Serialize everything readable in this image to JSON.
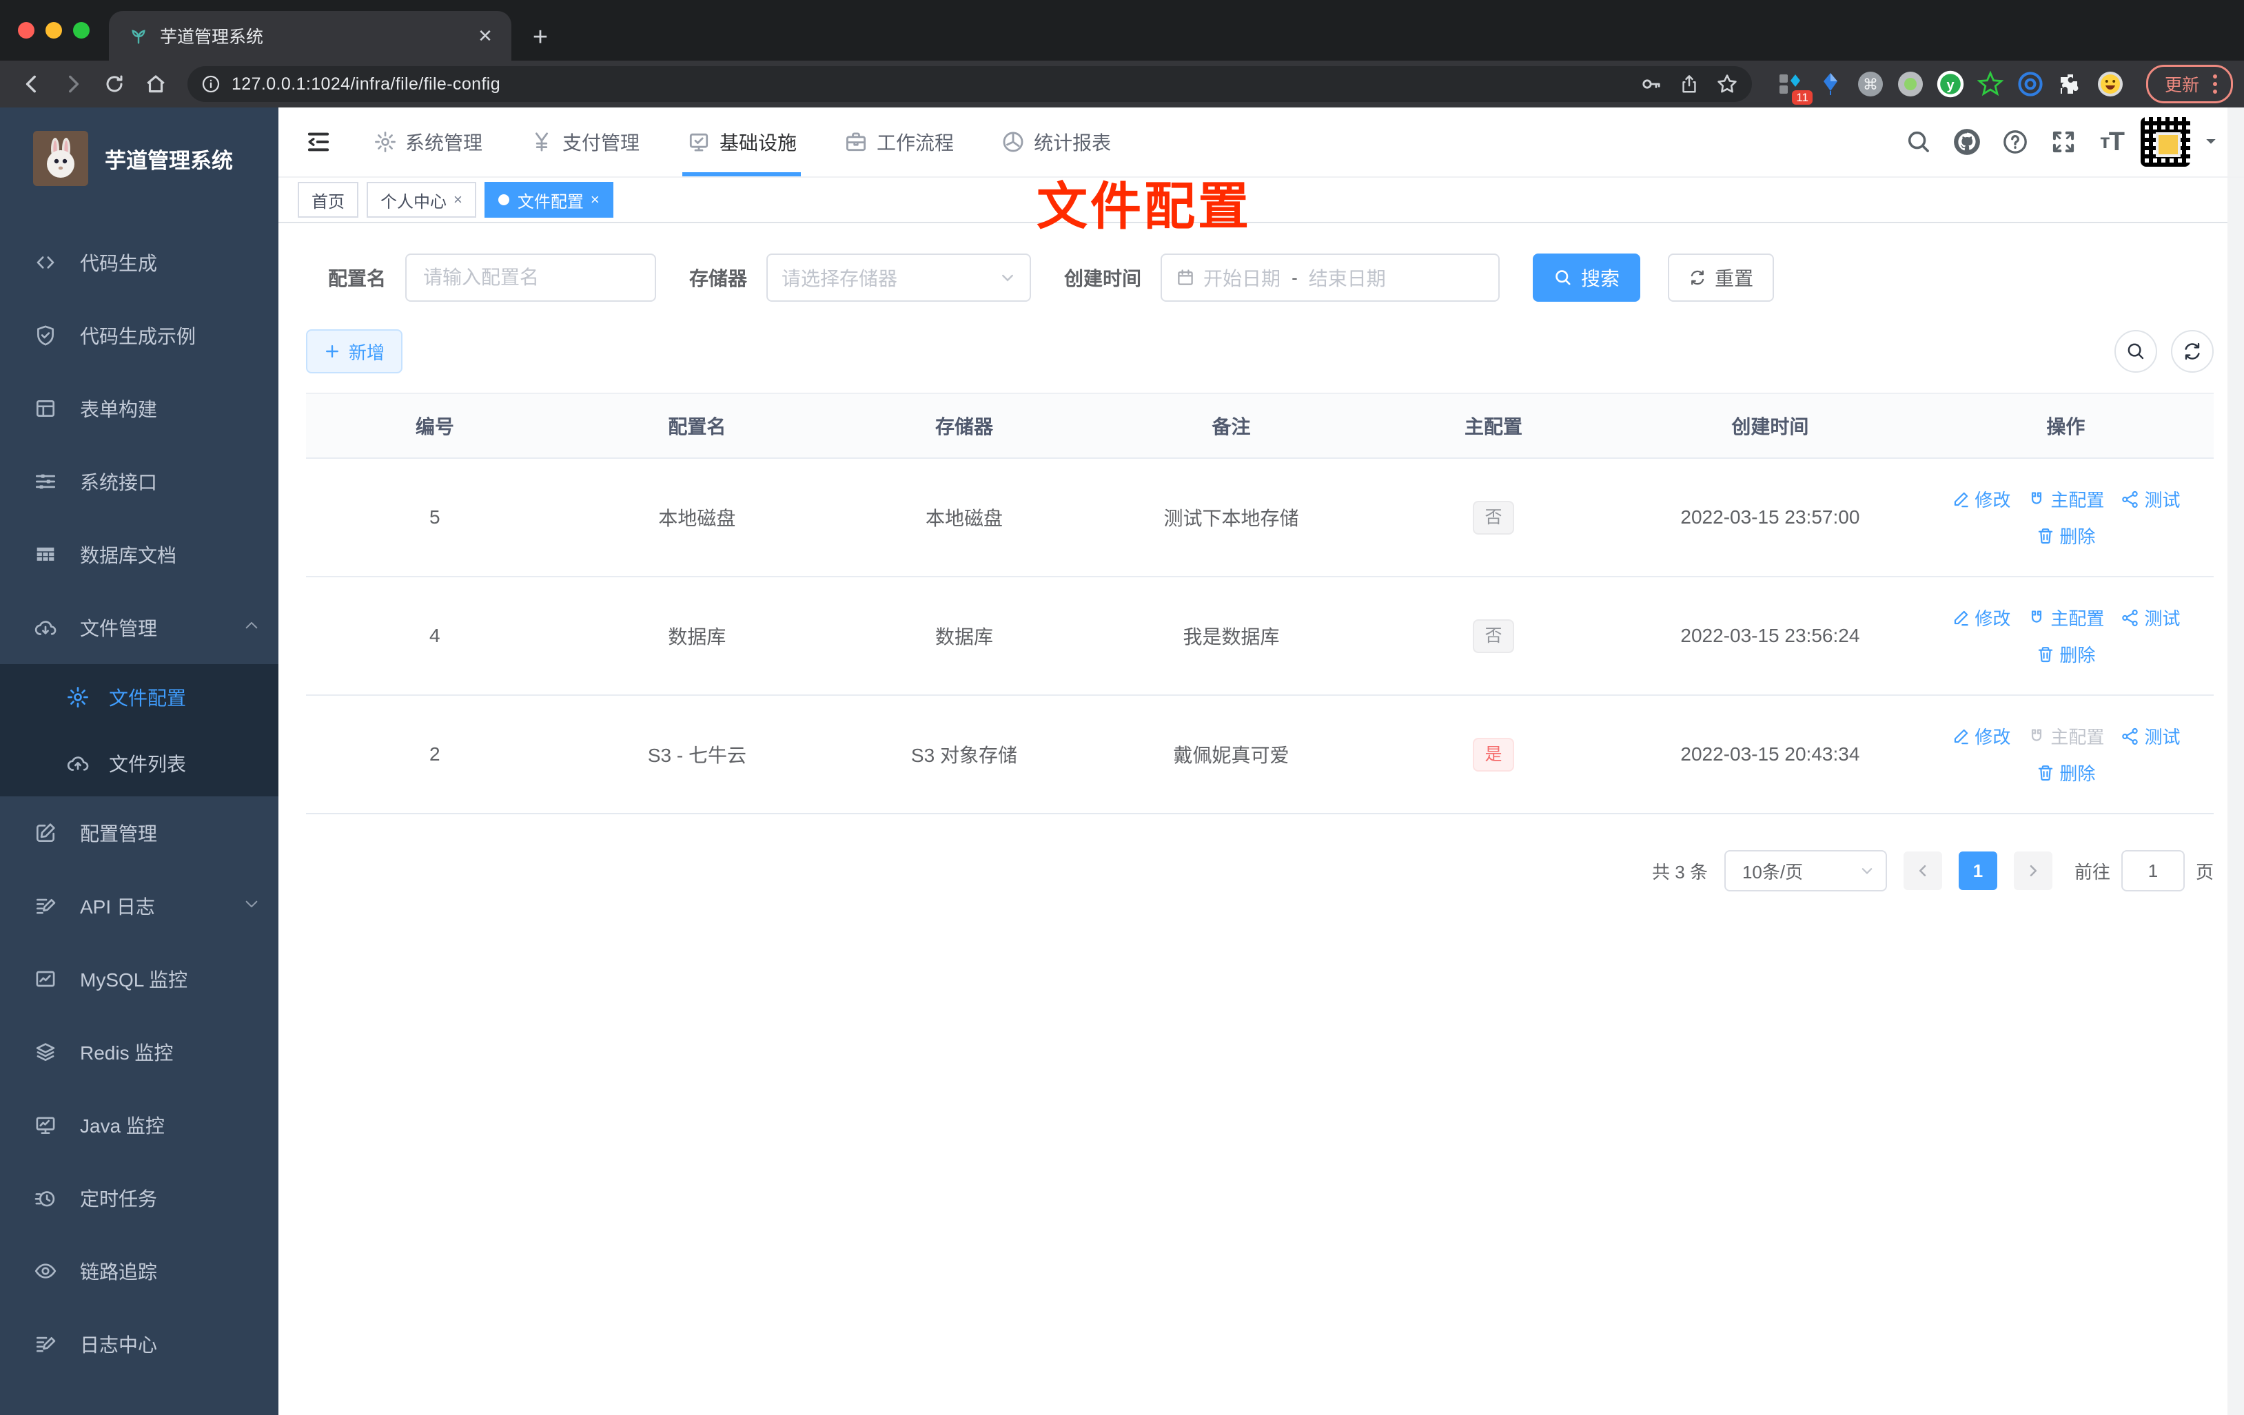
{
  "browser": {
    "tab_title": "芋道管理系统",
    "url": "127.0.0.1:1024/infra/file/file-config",
    "update_label": "更新",
    "extensions": [
      {
        "icon": "ext-grid-blue-icon",
        "badge": "11"
      },
      {
        "icon": "ext-kite-icon"
      },
      {
        "icon": "ext-command-icon"
      },
      {
        "icon": "ext-green-dot-icon"
      },
      {
        "icon": "ext-y-green-icon"
      },
      {
        "icon": "ext-star-green-icon"
      },
      {
        "icon": "ext-blue-rings-icon"
      },
      {
        "icon": "ext-puzzle-icon"
      },
      {
        "icon": "ext-emoji-icon"
      }
    ]
  },
  "header": {
    "nav": [
      {
        "label": "系统管理",
        "icon": "gear",
        "active": false
      },
      {
        "label": "支付管理",
        "icon": "yen",
        "active": false
      },
      {
        "label": "基础设施",
        "icon": "infra",
        "active": true
      },
      {
        "label": "工作流程",
        "icon": "briefcase",
        "active": false
      },
      {
        "label": "统计报表",
        "icon": "dashboard",
        "active": false
      }
    ]
  },
  "sidebar": {
    "title": "芋道管理系统",
    "items": [
      {
        "label": "代码生成",
        "icon": "code"
      },
      {
        "label": "代码生成示例",
        "icon": "shield-check"
      },
      {
        "label": "表单构建",
        "icon": "form-grid"
      },
      {
        "label": "系统接口",
        "icon": "sliders"
      },
      {
        "label": "数据库文档",
        "icon": "table-filled"
      },
      {
        "label": "文件管理",
        "icon": "cloud-download",
        "expanded": true,
        "children": [
          {
            "label": "文件配置",
            "icon": "gear",
            "active": true
          },
          {
            "label": "文件列表",
            "icon": "cloud-upload",
            "active": false
          }
        ]
      },
      {
        "label": "配置管理",
        "icon": "edit-square"
      },
      {
        "label": "API 日志",
        "icon": "log-edit",
        "collapsed": true
      },
      {
        "label": "MySQL 监控",
        "icon": "chart-box"
      },
      {
        "label": "Redis 监控",
        "icon": "layers"
      },
      {
        "label": "Java 监控",
        "icon": "monitor"
      },
      {
        "label": "定时任务",
        "icon": "timer"
      },
      {
        "label": "链路追踪",
        "icon": "eye"
      },
      {
        "label": "日志中心",
        "icon": "log-edit"
      }
    ]
  },
  "tags": [
    {
      "label": "首页",
      "closable": false,
      "active": false
    },
    {
      "label": "个人中心",
      "closable": true,
      "active": false
    },
    {
      "label": "文件配置",
      "closable": true,
      "active": true
    }
  ],
  "annotation": {
    "text": "文件配置",
    "color": "#ff2b00"
  },
  "filter": {
    "name_label": "配置名",
    "name_placeholder": "请输入配置名",
    "storage_label": "存储器",
    "storage_placeholder": "请选择存储器",
    "date_label": "创建时间",
    "date_start_placeholder": "开始日期",
    "date_separator": "-",
    "date_end_placeholder": "结束日期",
    "search_label": "搜索",
    "reset_label": "重置"
  },
  "toolbar": {
    "add_label": "新增"
  },
  "table": {
    "columns": [
      "编号",
      "配置名",
      "存储器",
      "备注",
      "主配置",
      "创建时间",
      "操作"
    ],
    "action_labels": {
      "edit": "修改",
      "master": "主配置",
      "test": "测试",
      "delete": "删除"
    },
    "rows": [
      {
        "id": "5",
        "name": "本地磁盘",
        "storage": "本地磁盘",
        "remark": "测试下本地存储",
        "master": "否",
        "master_type": "info",
        "created": "2022-03-15 23:57:00",
        "master_action_disabled": false
      },
      {
        "id": "4",
        "name": "数据库",
        "storage": "数据库",
        "remark": "我是数据库",
        "master": "否",
        "master_type": "info",
        "created": "2022-03-15 23:56:24",
        "master_action_disabled": false
      },
      {
        "id": "2",
        "name": "S3 - 七牛云",
        "storage": "S3 对象存储",
        "remark": "戴佩妮真可爱",
        "master": "是",
        "master_type": "danger",
        "created": "2022-03-15 20:43:34",
        "master_action_disabled": true
      }
    ]
  },
  "pagination": {
    "total": "共 3 条",
    "page_size": "10条/页",
    "current_page": "1",
    "goto_label": "前往",
    "goto_value": "1",
    "page_unit": "页"
  },
  "colors": {
    "accent": "#409eff",
    "danger": "#f56c6c",
    "annotation_red": "#ff2b00",
    "sidebar_bg": "#304156"
  }
}
